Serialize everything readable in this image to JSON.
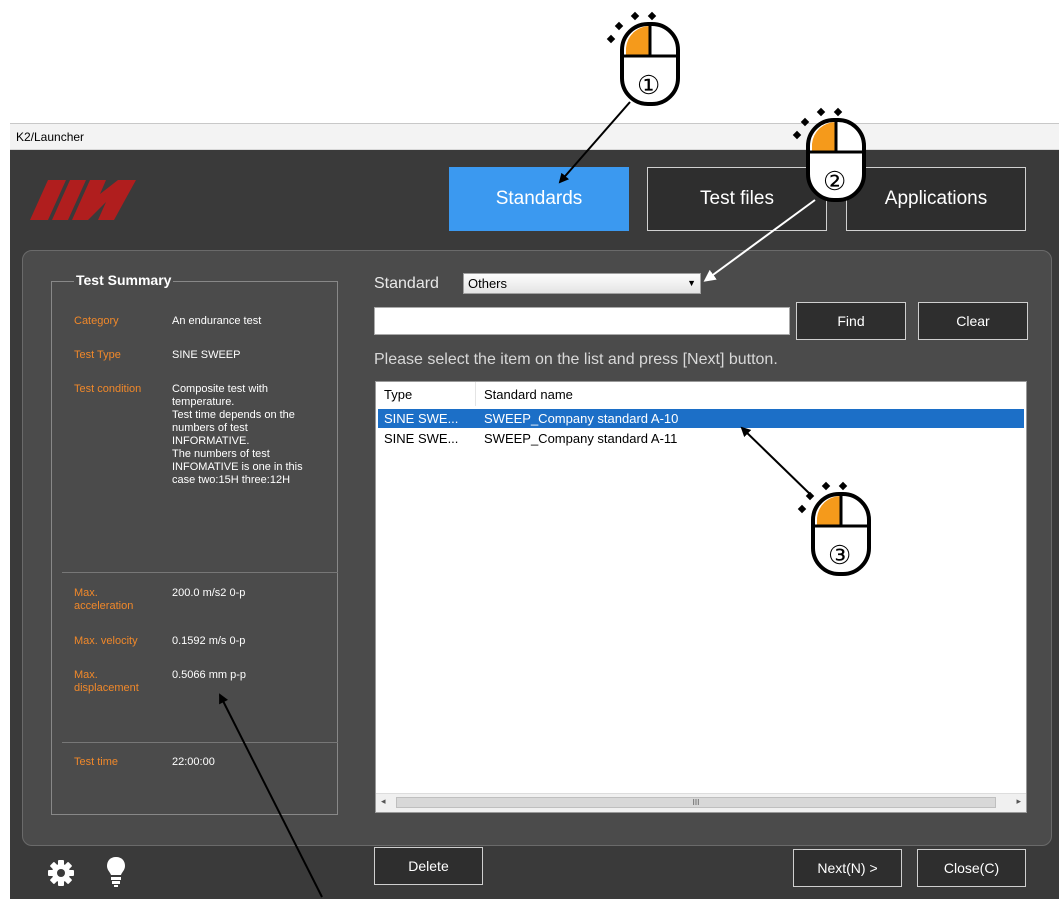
{
  "window": {
    "title": "K2/Launcher"
  },
  "top_nav": [
    "Standards",
    "Test files",
    "Applications"
  ],
  "summary": {
    "title": "Test Summary",
    "category_label": "Category",
    "category_value": "An endurance test",
    "test_type_label": "Test Type",
    "test_type_value": "SINE SWEEP",
    "test_condition_label": "Test condition",
    "test_condition_value": "Composite test with\ntemperature.\nTest time depends on the\nnumbers of test\nINFORMATIVE.\nThe numbers of test\nINFOMATIVE is one in this\ncase two:15H three:12H",
    "max_accel_label": "Max.\nacceleration",
    "max_accel_value": "200.0 m/s2 0-p",
    "max_velocity_label": "Max. velocity",
    "max_velocity_value": "0.1592 m/s 0-p",
    "max_disp_label": "Max.\ndisplacement",
    "max_disp_value": "0.5066 mm p-p",
    "test_time_label": "Test time",
    "test_time_value": "22:00:00"
  },
  "standard": {
    "label": "Standard",
    "selected": "Others"
  },
  "search": {
    "value": "",
    "find_label": "Find",
    "clear_label": "Clear"
  },
  "instruction": "Please select the item on the list and press [Next] button.",
  "list": {
    "headers": [
      "Type",
      "Standard name"
    ],
    "rows": [
      {
        "type": "SINE SWE...",
        "name": "SWEEP_Company standard  A-10"
      },
      {
        "type": "SINE SWE...",
        "name": "SWEEP_Company standard  A-11"
      }
    ],
    "scroll_grip": "III"
  },
  "bottom": {
    "delete_label": "Delete",
    "next_label": "Next(N) >",
    "close_label": "Close(C)"
  },
  "callouts": [
    "①",
    "②",
    "③"
  ],
  "colors": {
    "accent": "#3b99f0",
    "label_orange": "#f0882a",
    "mouse_orange": "#f59a1b",
    "logo_red": "#b01e1e"
  },
  "icons": [
    "gear-icon",
    "lightbulb-icon",
    "logo",
    "dropdown-arrow-icon",
    "mouse-icon"
  ]
}
